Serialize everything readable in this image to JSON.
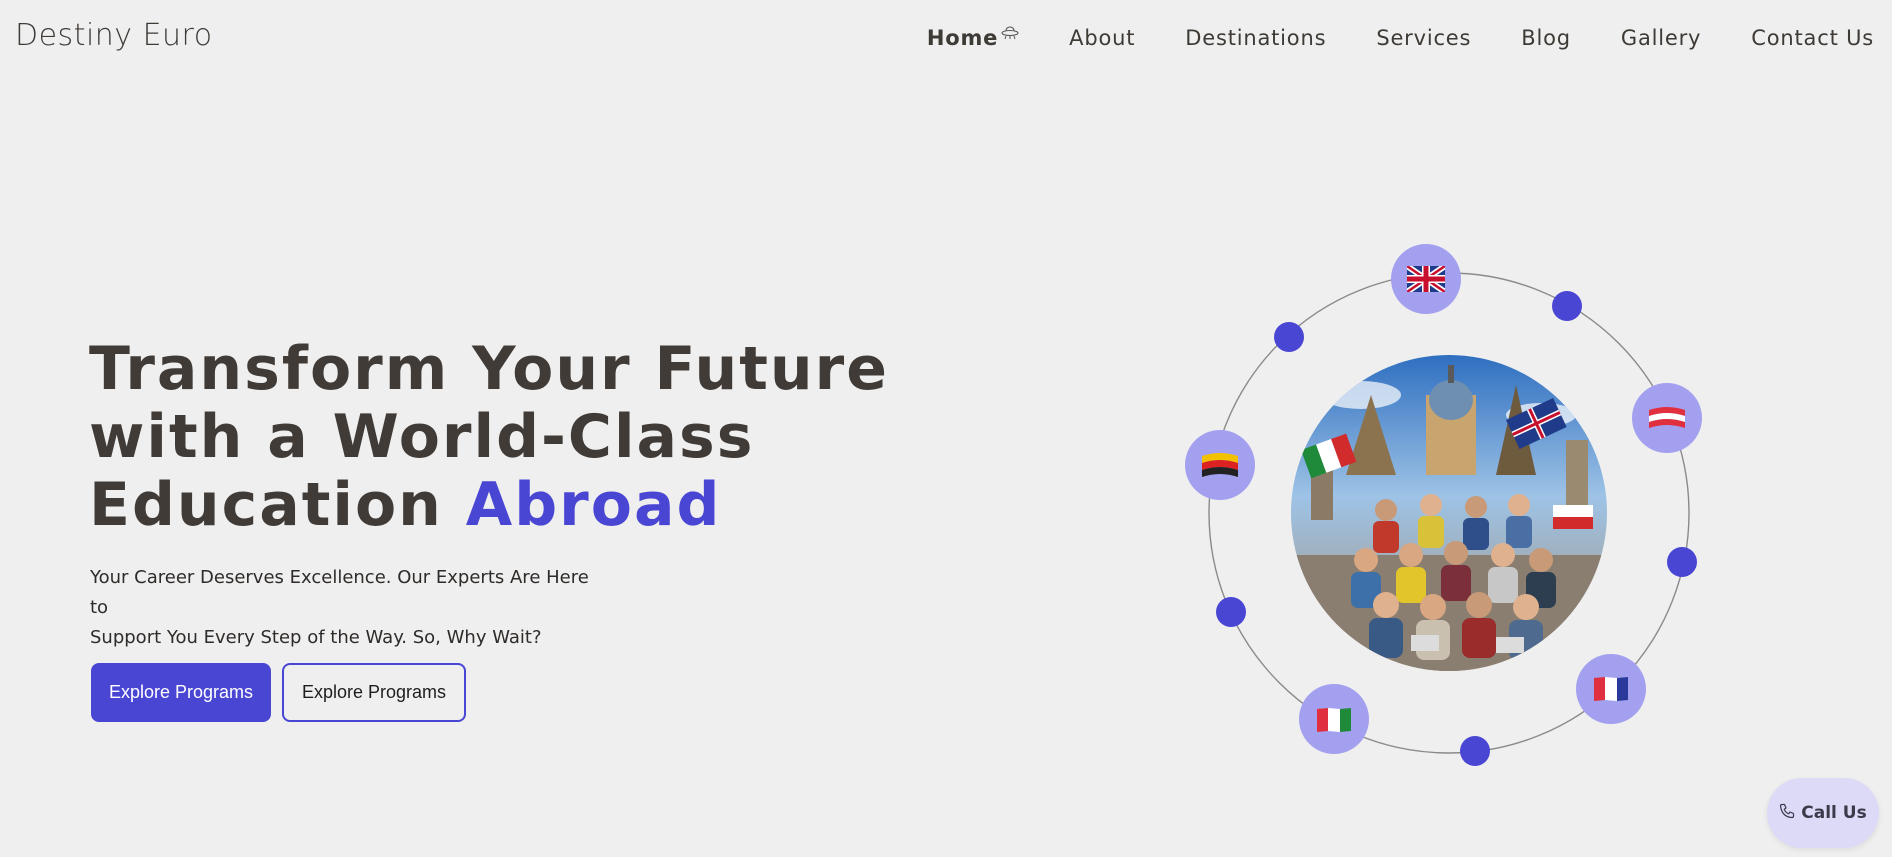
{
  "brand": {
    "name": "Destiny Euro"
  },
  "nav": {
    "items": [
      {
        "label": "Home",
        "active": true,
        "icon": "ufo-icon"
      },
      {
        "label": "About"
      },
      {
        "label": "Destinations"
      },
      {
        "label": "Services"
      },
      {
        "label": "Blog"
      },
      {
        "label": "Gallery"
      },
      {
        "label": "Contact Us"
      }
    ]
  },
  "hero": {
    "title_line1": "Transform Your Future",
    "title_line2": "with a World-Class",
    "title_line3_prefix": "Education ",
    "title_accent": "Abroad",
    "subtitle_line1": "Your Career Deserves Excellence. Our Experts Are Here to",
    "subtitle_line2": "Support You Every Step of the Way. So, Why Wait?",
    "primary_button": "Explore Programs",
    "secondary_button": "Explore Programs"
  },
  "orbit": {
    "flags": [
      "uk-flag-icon",
      "austria-flag-icon",
      "germany-flag-icon",
      "france-flag-icon",
      "italy-flag-icon"
    ],
    "image": "students-studying-abroad-image"
  },
  "call_button": {
    "label": "Call Us",
    "icon": "phone-icon"
  },
  "colors": {
    "accent": "#4a46d4",
    "badge": "#a3a0f0",
    "background": "#efefef",
    "text": "#3e3a36"
  }
}
